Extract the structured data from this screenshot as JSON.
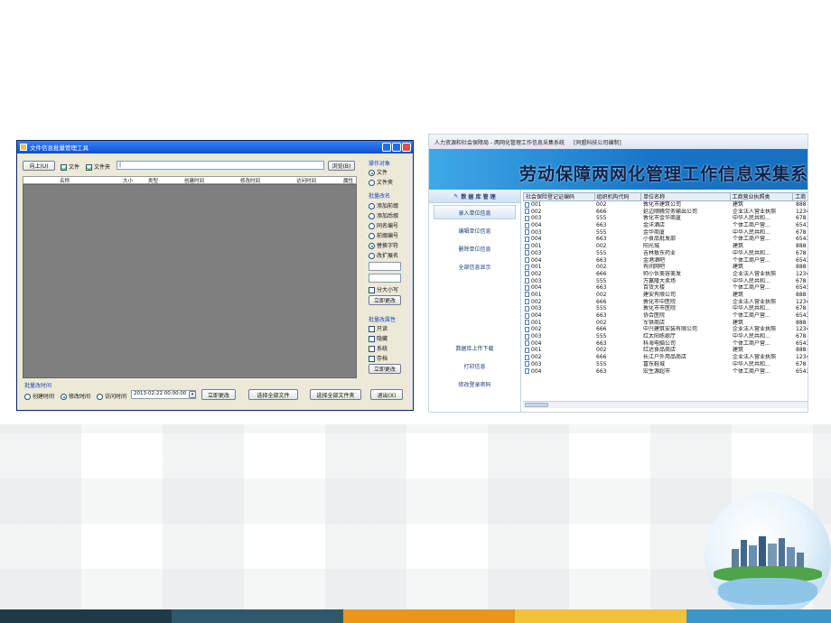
{
  "colors": {
    "bottom_bar": [
      "#1e3a48",
      "#2c5a6a",
      "#e8951a",
      "#f2c23a",
      "#3c97c9"
    ]
  },
  "left_window": {
    "title": "文件信息批量管理工具",
    "up_button": "向上(U)",
    "check_file": "文件",
    "check_folder": "文件夹",
    "path_value": "|",
    "browse_button": "浏览(B)",
    "columns": [
      "名称",
      "大小",
      "类型",
      "创建时间",
      "修改时间",
      "访问时间",
      "属性"
    ],
    "operate_group": "操作对象",
    "operate_options": [
      "文件",
      "文件夹"
    ],
    "rename_group": "批量改名",
    "rename_options": [
      "添加前缀",
      "添加后缀",
      "同名编号",
      "前缀编号",
      "替换字符",
      "改扩展名"
    ],
    "case_check": "分大小写",
    "apply_button_1": "立即更改",
    "attr_group": "批量改属性",
    "attr_options": [
      "只读",
      "隐藏",
      "系统",
      "存档"
    ],
    "apply_button_2": "立即更改",
    "time_group": "批量改时间",
    "time_options": [
      "创建时间",
      "修改时间",
      "访问时间"
    ],
    "datetime_value": "2013-02-22 00:00:00",
    "apply_button_3": "立即更改",
    "select_all_files": "选择全部文件",
    "select_all_folders": "选择全部文件夹",
    "exit_button": "退出(X)"
  },
  "right_window": {
    "title": "人力资源和社会保障局 - 两网化管理工作信息采集系统",
    "title_company": "[同盟科技公司编制]",
    "banner": "劳动保障两网化管理工作信息采集系",
    "sidebar_head": "数 据 库 管 理",
    "sidebar_items": [
      "录入单位信息",
      "编辑单位信息",
      "删除单位信息",
      "全部信息显示"
    ],
    "sidebar_bottom": [
      "数据库上传下载",
      "打印信息",
      "修改登录密码"
    ],
    "columns": [
      "社会保险登记证编码",
      "组织机构代码",
      "单位名称",
      "工商营业执照类",
      "工商"
    ],
    "rows": [
      [
        "001",
        "002",
        "敦化市建筑公司",
        "建筑",
        "888"
      ],
      [
        "002",
        "666",
        "延边顺腾劳务输出公司",
        "企业法人营业执照",
        "1234"
      ],
      [
        "003",
        "555",
        "敦化市金华商厦",
        "中华人民共和...",
        "678"
      ],
      [
        "004",
        "663",
        "金洋酒店",
        "个体工商户营...",
        "6543"
      ],
      [
        "003",
        "555",
        "金华商厦",
        "中华人民共和...",
        "678"
      ],
      [
        "004",
        "663",
        "小食品批发部",
        "个体工商户营...",
        "6543"
      ],
      [
        "001",
        "002",
        "阳光城",
        "建筑",
        "888"
      ],
      [
        "003",
        "555",
        "吉林敖东药业",
        "中华人民共和...",
        "678"
      ],
      [
        "004",
        "663",
        "金港酒吧",
        "个体工商户营...",
        "6543"
      ],
      [
        "001",
        "002",
        "有间网吧",
        "建筑",
        "888"
      ],
      [
        "002",
        "666",
        "帅小伙美容美发",
        "企业法人营业执照",
        "1234"
      ],
      [
        "003",
        "555",
        "万赢隆大卖场",
        "中华人民共和...",
        "678"
      ],
      [
        "004",
        "663",
        "百货大楼",
        "个体工商户营...",
        "6543"
      ],
      [
        "001",
        "002",
        "建安有限公司",
        "建筑",
        "888"
      ],
      [
        "002",
        "666",
        "敦化市中医院",
        "企业法人营业执照",
        "1234"
      ],
      [
        "003",
        "555",
        "敦化市市医院",
        "中华人民共和...",
        "678"
      ],
      [
        "004",
        "663",
        "协合医院",
        "个体工商户营...",
        "6543"
      ],
      [
        "001",
        "002",
        "军供商店",
        "建筑",
        "888"
      ],
      [
        "002",
        "666",
        "中兴建筑安装有限公司",
        "企业法人营业执照",
        "1234"
      ],
      [
        "003",
        "555",
        "红太阳练歌厅",
        "中华人民共和...",
        "678"
      ],
      [
        "004",
        "663",
        "科海电脑公司",
        "个体工商户营...",
        "6543"
      ],
      [
        "001",
        "002",
        "红达食品商店",
        "建筑",
        "888"
      ],
      [
        "002",
        "666",
        "长江户外用品商店",
        "企业法人营业执照",
        "1234"
      ],
      [
        "003",
        "555",
        "富东鞋城",
        "中华人民共和...",
        "678"
      ],
      [
        "004",
        "663",
        "宏生源超市",
        "个体工商户营...",
        "6543"
      ]
    ]
  }
}
